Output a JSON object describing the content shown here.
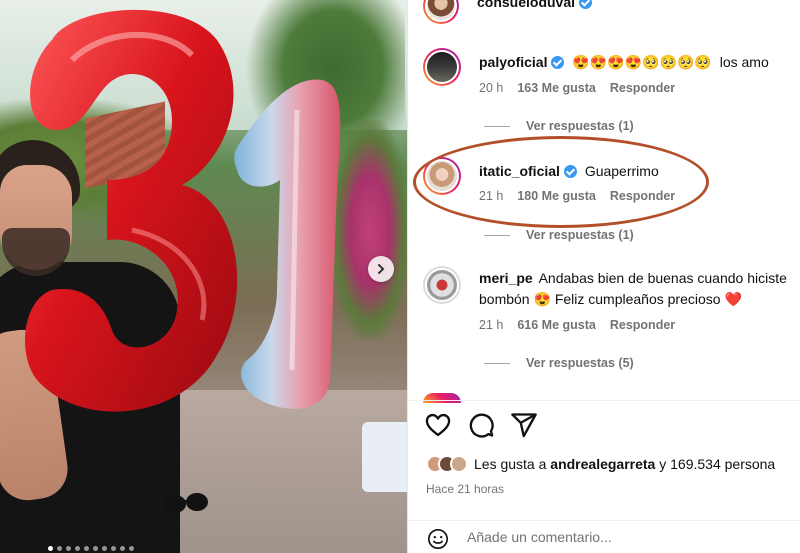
{
  "post": {
    "author": "consueloduval"
  },
  "comments": [
    {
      "username": "palyoficial",
      "verified": true,
      "emojis": "😍😍😍😍🥺🥺🥺🥺",
      "text": "los amo",
      "time": "20 h",
      "likes": "163 Me gusta",
      "reply": "Responder",
      "view_replies": "Ver respuestas (1)"
    },
    {
      "username": "itatic_oficial",
      "verified": true,
      "text": "Guaperrimo",
      "time": "21 h",
      "likes": "180 Me gusta",
      "reply": "Responder",
      "view_replies": "Ver respuestas (1)"
    },
    {
      "username": "meri_pe",
      "verified": false,
      "text_line1": "Andabas bien de buenas cuando hiciste",
      "text_line2_a": "bombón",
      "emoji1": "😍",
      "text_line2_b": "Feliz cumpleaños precioso",
      "emoji2": "❤️",
      "time": "21 h",
      "likes": "616 Me gusta",
      "reply": "Responder",
      "view_replies": "Ver respuestas (5)"
    }
  ],
  "likes_summary": {
    "prefix": "Les gusta a",
    "user": "andrealegarreta",
    "suffix": "y 169.534 persona"
  },
  "time_ago": "Hace 21 horas",
  "comment_input": {
    "placeholder": "Añade un comentario..."
  },
  "balloon_text": "31",
  "icons": {
    "like": "heart-icon",
    "comment": "comment-bubble-icon",
    "share": "paper-plane-icon",
    "emoji": "smiley-icon",
    "next": "chevron-right-icon"
  },
  "colors": {
    "highlight_ring": "#b3502a",
    "verified": "#3897f0",
    "heart": "#ed1c24"
  }
}
